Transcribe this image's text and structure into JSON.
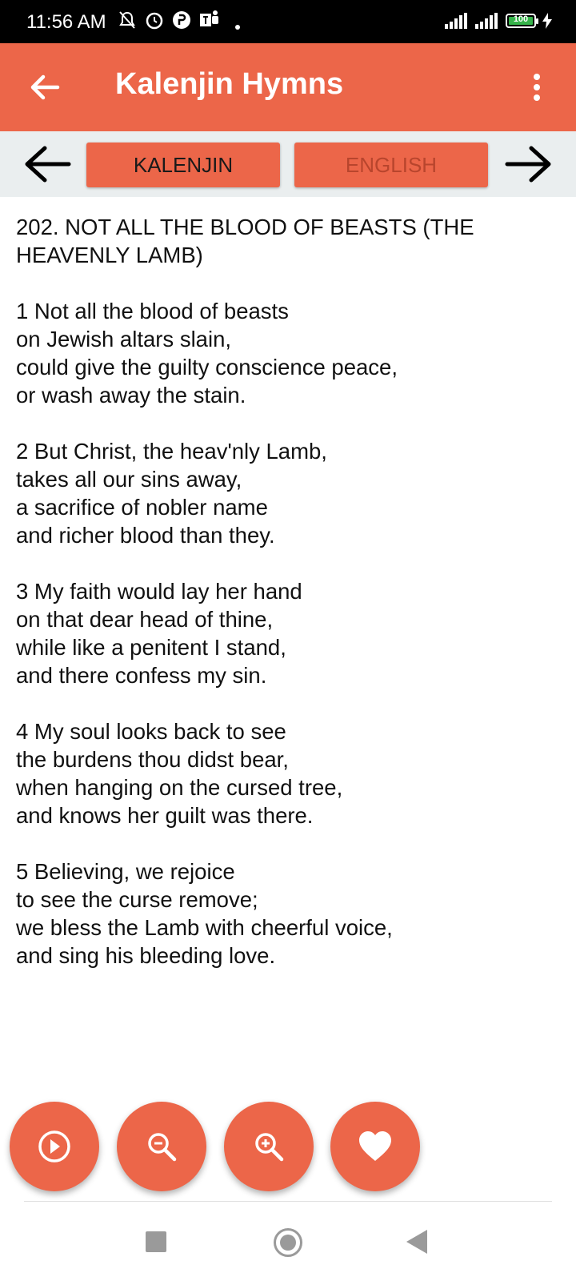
{
  "status_bar": {
    "time": "11:56 AM",
    "battery_level": "100",
    "icons": [
      "mute-icon",
      "alarm-icon",
      "p-icon",
      "teams-icon",
      "signal-icon",
      "signal-icon",
      "battery-icon",
      "charging-icon"
    ]
  },
  "app_bar": {
    "title": "Kalenjin Hymns",
    "back_icon": "arrow-left-icon",
    "menu_icon": "more-vert-icon"
  },
  "toolbar": {
    "prev_icon": "arrow-left-icon",
    "next_icon": "arrow-right-icon",
    "tab_kalenjin": "KALENJIN",
    "tab_english": "ENGLISH"
  },
  "hymn": {
    "title_line1": "202. NOT ALL THE BLOOD OF BEASTS (THE",
    "title_line2": "HEAVENLY LAMB)",
    "stanzas": [
      [
        "1 Not all the blood of beasts",
        "on Jewish altars slain,",
        "could give the guilty conscience peace,",
        "or wash away the stain."
      ],
      [
        "2 But Christ, the heav'nly Lamb,",
        "takes all our sins away,",
        "a sacrifice of nobler name",
        "and richer blood than they."
      ],
      [
        "3 My faith would lay her hand",
        "on that dear head of thine,",
        "while like a penitent I stand,",
        "and there confess my sin."
      ],
      [
        "4 My soul looks back to see",
        "the burdens thou didst bear,",
        "when hanging on the cursed tree,",
        "and knows her guilt was there."
      ],
      [
        "5 Believing, we rejoice",
        "to see the curse remove;",
        "we bless the Lamb with cheerful voice,",
        "and sing his bleeding love."
      ]
    ]
  },
  "fabs": {
    "play_icon": "play-circle-icon",
    "zoom_out_icon": "zoom-out-icon",
    "zoom_in_icon": "zoom-in-icon",
    "favorite_icon": "heart-icon"
  },
  "colors": {
    "accent": "#ec6649",
    "toolbar_bg": "#eaeeef"
  }
}
